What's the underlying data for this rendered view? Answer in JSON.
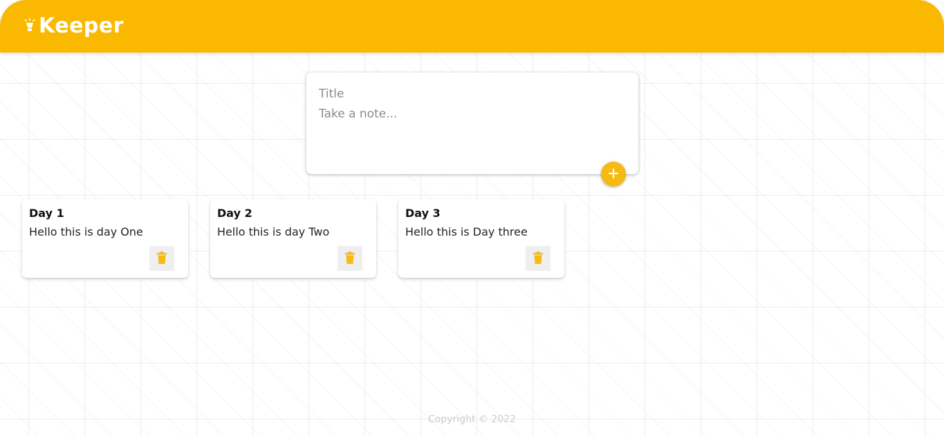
{
  "header": {
    "app_name": "Keeper",
    "logo_icon": "lightbulb-icon",
    "color": "#fbb800"
  },
  "composer": {
    "title_placeholder": "Title",
    "content_placeholder": "Take a note...",
    "add_icon": "plus-icon",
    "accent": "#f5ba13"
  },
  "notes": [
    {
      "title": "Day 1",
      "content": "Hello this is day One",
      "delete_icon": "trash-icon"
    },
    {
      "title": "Day 2",
      "content": "Hello this is day Two",
      "delete_icon": "trash-icon"
    },
    {
      "title": "Day 3",
      "content": "Hello this is Day three",
      "delete_icon": "trash-icon"
    }
  ],
  "footer": {
    "text": "Copyright © 2022"
  }
}
